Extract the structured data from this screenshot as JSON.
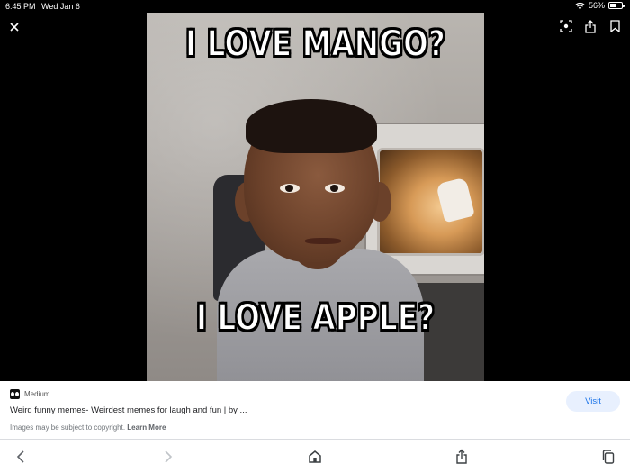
{
  "status_bar": {
    "time": "6:45 PM",
    "date": "Wed Jan 6",
    "battery_text": "56%",
    "battery_level": 0.56
  },
  "viewer": {
    "close_icon": "close-icon",
    "actions": [
      "lens-icon",
      "share-icon",
      "bookmark-icon"
    ]
  },
  "meme": {
    "top_text": "I LOVE MANGO?",
    "bottom_text": "I LOVE APPLE?"
  },
  "info": {
    "source_icon": "medium-logo-icon",
    "source_name": "Medium",
    "title": "Weird funny memes- Weirdest memes for laugh and fun | by ...",
    "copyright_prefix": "Images may be subject to copyright.",
    "learn_more": "Learn More",
    "visit_label": "Visit",
    "accent_color": "#1a73e8"
  },
  "toolbar": {
    "items": [
      "back-icon",
      "forward-icon",
      "home-icon",
      "share-icon",
      "tabs-icon"
    ]
  }
}
